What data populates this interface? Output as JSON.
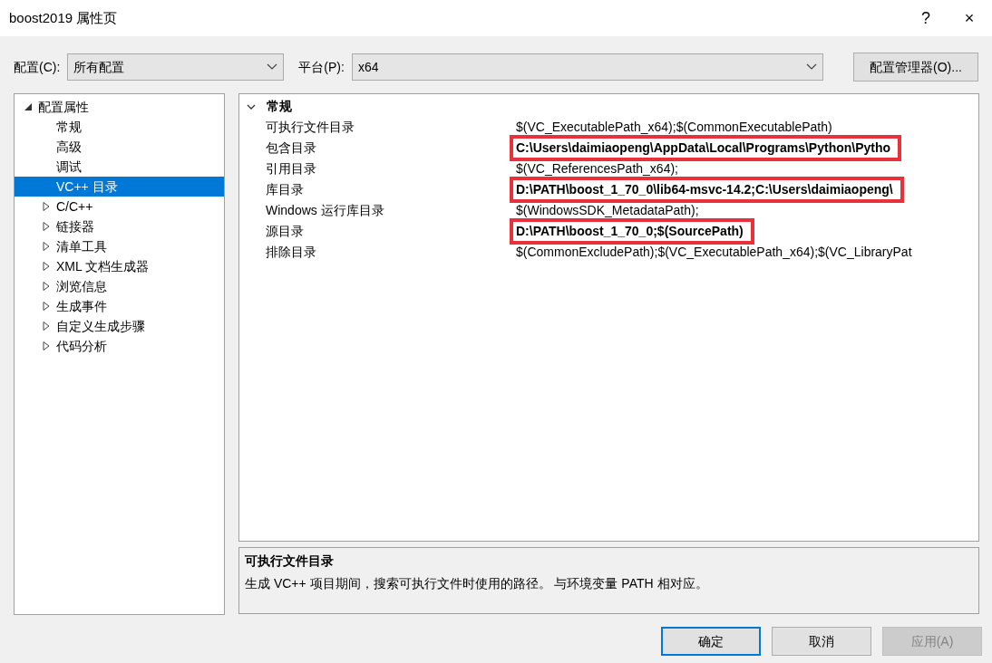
{
  "window": {
    "title": "boost2019 属性页",
    "help": "?",
    "close": "×"
  },
  "toolbar": {
    "config_label": "配置(C):",
    "config_value": "所有配置",
    "platform_label": "平台(P):",
    "platform_value": "x64",
    "manager_button": "配置管理器(O)..."
  },
  "tree": [
    {
      "label": "配置属性",
      "expanded": true,
      "selected": false,
      "children": [
        {
          "label": "常规",
          "selected": false
        },
        {
          "label": "高级",
          "selected": false
        },
        {
          "label": "调试",
          "selected": false
        },
        {
          "label": "VC++ 目录",
          "selected": true
        },
        {
          "label": "C/C++",
          "expanded": false,
          "selected": false
        },
        {
          "label": "链接器",
          "expanded": false,
          "selected": false
        },
        {
          "label": "清单工具",
          "expanded": false,
          "selected": false
        },
        {
          "label": "XML 文档生成器",
          "expanded": false,
          "selected": false
        },
        {
          "label": "浏览信息",
          "expanded": false,
          "selected": false
        },
        {
          "label": "生成事件",
          "expanded": false,
          "selected": false
        },
        {
          "label": "自定义生成步骤",
          "expanded": false,
          "selected": false
        },
        {
          "label": "代码分析",
          "expanded": false,
          "selected": false
        }
      ]
    }
  ],
  "grid": {
    "category": "常规",
    "expanded": true,
    "properties": [
      {
        "name": "可执行文件目录",
        "value": "$(VC_ExecutablePath_x64);$(CommonExecutablePath)",
        "bold": false,
        "highlighted": false
      },
      {
        "name": "包含目录",
        "value": "C:\\Users\\daimiaopeng\\AppData\\Local\\Programs\\Python\\Pytho",
        "bold": true,
        "highlighted": true
      },
      {
        "name": "引用目录",
        "value": "$(VC_ReferencesPath_x64);",
        "bold": false,
        "highlighted": false
      },
      {
        "name": "库目录",
        "value": "D:\\PATH\\boost_1_70_0\\lib64-msvc-14.2;C:\\Users\\daimiaopeng\\",
        "bold": true,
        "highlighted": true
      },
      {
        "name": "Windows 运行库目录",
        "value": "$(WindowsSDK_MetadataPath);",
        "bold": false,
        "highlighted": false
      },
      {
        "name": "源目录",
        "value": "D:\\PATH\\boost_1_70_0;$(SourcePath)",
        "bold": true,
        "highlighted": true
      },
      {
        "name": "排除目录",
        "value": "$(CommonExcludePath);$(VC_ExecutablePath_x64);$(VC_LibraryPat",
        "bold": false,
        "highlighted": false
      }
    ]
  },
  "description": {
    "title": "可执行文件目录",
    "text": "生成 VC++ 项目期间，搜索可执行文件时使用的路径。 与环境变量 PATH 相对应。"
  },
  "buttons": [
    {
      "label": "确定",
      "default": true,
      "disabled": false
    },
    {
      "label": "取消",
      "default": false,
      "disabled": false
    },
    {
      "label": "应用(A)",
      "default": false,
      "disabled": true
    }
  ]
}
